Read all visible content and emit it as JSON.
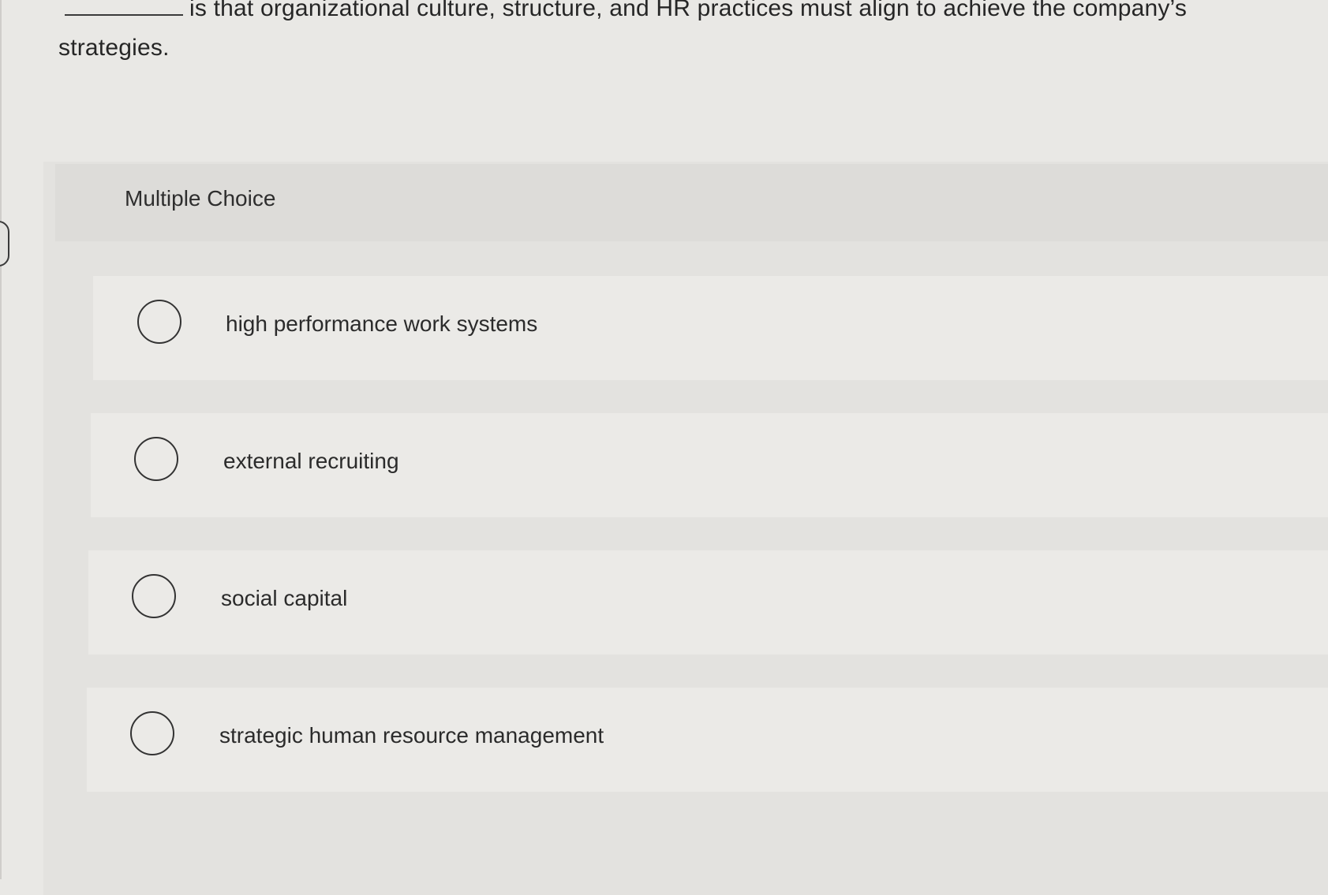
{
  "question": {
    "text_before_blank": "",
    "text_after_blank": "is that organizational culture, structure, and HR practices must align to achieve the company’s strategies."
  },
  "multiple_choice": {
    "title": "Multiple Choice",
    "options": [
      {
        "label": "high performance work systems"
      },
      {
        "label": "external recruiting"
      },
      {
        "label": "social capital"
      },
      {
        "label": "strategic human resource management"
      }
    ]
  }
}
